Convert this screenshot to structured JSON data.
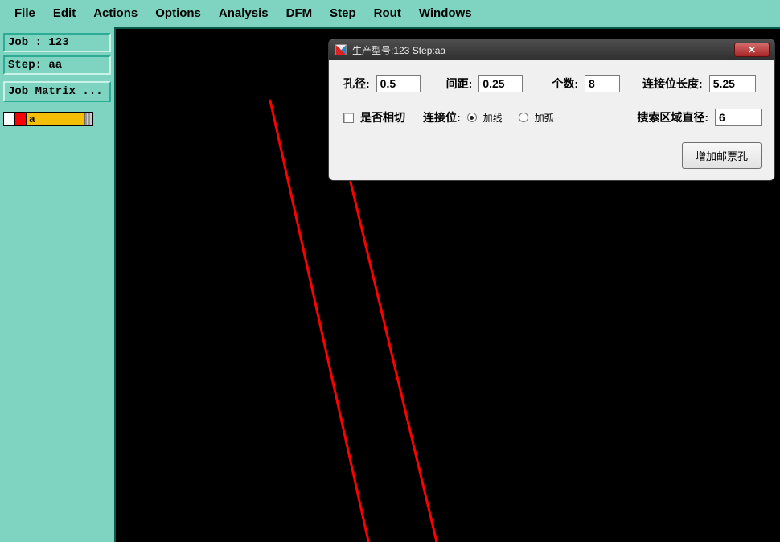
{
  "menubar": {
    "file": "File",
    "edit": "Edit",
    "actions": "Actions",
    "options": "Options",
    "analysis": "Analysis",
    "dfm": "DFM",
    "step": "Step",
    "rout": "Rout",
    "windows": "Windows"
  },
  "left": {
    "job_line": "Job : 123",
    "step_line": "Step: aa",
    "matrix_btn": "Job Matrix ...",
    "layer_label": "a"
  },
  "dialog": {
    "title": "生产型号:123 Step:aa",
    "aperture_label": "孔径:",
    "aperture_value": "0.5",
    "spacing_label": "间距:",
    "spacing_value": "0.25",
    "count_label": "个数:",
    "count_value": "8",
    "conn_len_label": "连接位长度:",
    "conn_len_value": "5.25",
    "tangent_label": "是否相切",
    "conn_pos_label": "连接位:",
    "radio_line": "加线",
    "radio_arc": "加弧",
    "search_dia_label": "搜索区域直径:",
    "search_dia_value": "6",
    "submit_btn": "增加邮票孔"
  }
}
